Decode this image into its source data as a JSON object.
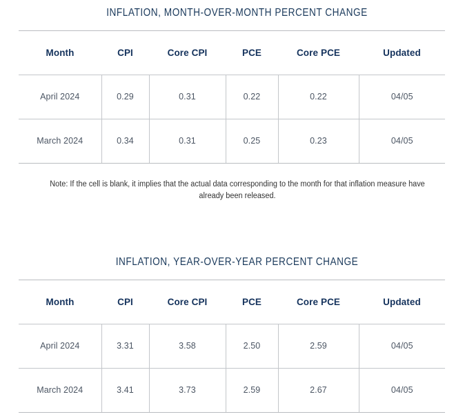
{
  "page": {
    "background_color": "#ffffff",
    "accent_color": "#1b3a5c",
    "header_color": "#14325c",
    "cell_text_color": "#4b5563",
    "border_color": "#c3c6ca"
  },
  "tables": [
    {
      "id": "month-over-month",
      "title": "INFLATION, MONTH-OVER-MONTH PERCENT CHANGE",
      "columns": [
        "Month",
        "CPI",
        "Core CPI",
        "PCE",
        "Core PCE",
        "Updated"
      ],
      "rows": [
        [
          "April 2024",
          "0.29",
          "0.31",
          "0.22",
          "0.22",
          "04/05"
        ],
        [
          "March 2024",
          "0.34",
          "0.31",
          "0.25",
          "0.23",
          "04/05"
        ]
      ],
      "note": "Note: If the cell is blank, it implies that the actual data corresponding to the month for that inflation measure have already been released."
    },
    {
      "id": "year-over-year",
      "title": "INFLATION, YEAR-OVER-YEAR PERCENT CHANGE",
      "columns": [
        "Month",
        "CPI",
        "Core CPI",
        "PCE",
        "Core PCE",
        "Updated"
      ],
      "rows": [
        [
          "April 2024",
          "3.31",
          "3.58",
          "2.50",
          "2.59",
          "04/05"
        ],
        [
          "March 2024",
          "3.41",
          "3.73",
          "2.59",
          "2.67",
          "04/05"
        ]
      ],
      "note": ""
    }
  ],
  "chart_data": {
    "type": "table",
    "title": "Inflation percent change summary",
    "tables": [
      {
        "title": "INFLATION, MONTH-OVER-MONTH PERCENT CHANGE",
        "categories": [
          "Month",
          "CPI",
          "Core CPI",
          "PCE",
          "Core PCE",
          "Updated"
        ],
        "series": [
          {
            "name": "April 2024",
            "values": [
              0.29,
              0.31,
              0.22,
              0.22
            ],
            "updated": "04/05"
          },
          {
            "name": "March 2024",
            "values": [
              0.34,
              0.31,
              0.25,
              0.23
            ],
            "updated": "04/05"
          }
        ],
        "value_columns": [
          "CPI",
          "Core CPI",
          "PCE",
          "Core PCE"
        ]
      },
      {
        "title": "INFLATION, YEAR-OVER-YEAR PERCENT CHANGE",
        "categories": [
          "Month",
          "CPI",
          "Core CPI",
          "PCE",
          "Core PCE",
          "Updated"
        ],
        "series": [
          {
            "name": "April 2024",
            "values": [
              3.31,
              3.58,
              2.5,
              2.59
            ],
            "updated": "04/05"
          },
          {
            "name": "March 2024",
            "values": [
              3.41,
              3.73,
              2.59,
              2.67
            ],
            "updated": "04/05"
          }
        ],
        "value_columns": [
          "CPI",
          "Core CPI",
          "PCE",
          "Core PCE"
        ]
      }
    ]
  }
}
